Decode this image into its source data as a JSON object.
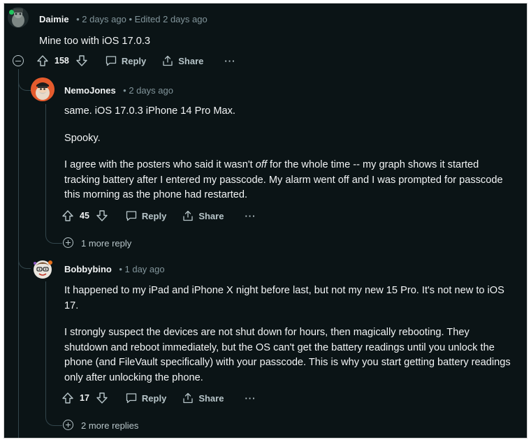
{
  "comments": [
    {
      "author": "Daimie",
      "meta": "• 2 days ago • Edited 2 days ago",
      "paragraphs": [
        "Mine too with iOS 17.0.3"
      ],
      "votes": "158"
    },
    {
      "author": "NemoJones",
      "meta": "• 2 days ago",
      "p1": "same. iOS 17.0.3 iPhone 14 Pro Max.",
      "p2": "Spooky.",
      "p3_before": "I agree with the posters who said it wasn't ",
      "p3_em": "off",
      "p3_after": " for the whole time -- my graph shows it started tracking battery after I entered my passcode. My alarm went off and I was prompted for passcode this morning as the phone had restarted.",
      "votes": "45",
      "more": "1 more reply"
    },
    {
      "author": "Bobbybino",
      "meta": "• 1 day ago",
      "p1": "It happened to my iPad and iPhone X night before last, but not my new 15 Pro. It's not new to iOS 17.",
      "p2": "I strongly suspect the devices are not shut down for hours, then magically rebooting. They shutdown and reboot immediately, but the OS can't get the battery readings until you unlock the phone (and FileVault specifically) with your passcode. This is why you start getting battery readings only after unlocking the phone.",
      "votes": "17",
      "more": "2 more replies"
    }
  ],
  "labels": {
    "reply": "Reply",
    "share": "Share",
    "overflow": "···"
  },
  "colors": {
    "background": "#0b1416",
    "text": "#f2f4f5",
    "muted": "#82959b",
    "thread": "#33464c"
  }
}
